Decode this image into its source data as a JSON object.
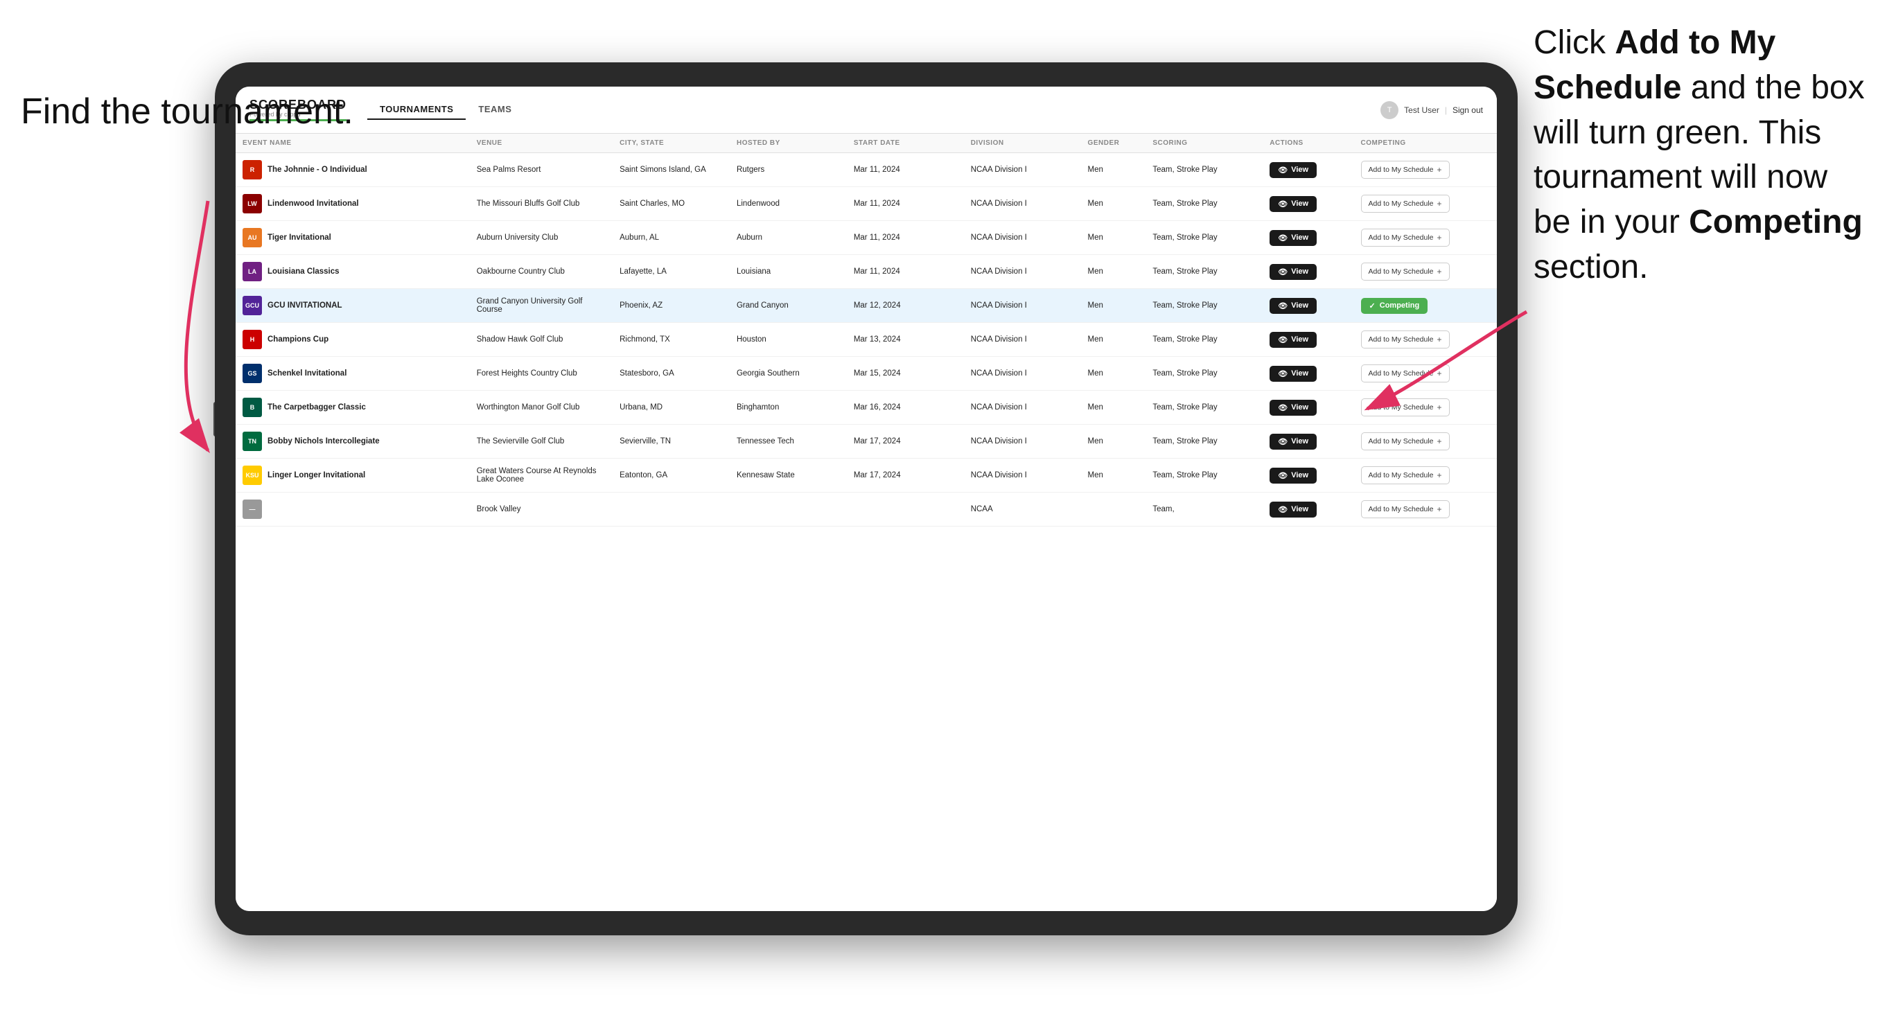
{
  "annotations": {
    "left_title": "Find the tournament.",
    "right_title_pre": "Click ",
    "right_title_bold1": "Add to My Schedule",
    "right_title_mid": " and the box will turn green. This tournament will now be in your ",
    "right_title_bold2": "Competing",
    "right_title_post": " section."
  },
  "header": {
    "logo": "SCOREBOARD",
    "logo_powered": "Powered by clippd",
    "nav": [
      "TOURNAMENTS",
      "TEAMS"
    ],
    "active_nav": "TOURNAMENTS",
    "user_label": "Test User",
    "signout_label": "Sign out"
  },
  "table": {
    "columns": [
      "EVENT NAME",
      "VENUE",
      "CITY, STATE",
      "HOSTED BY",
      "START DATE",
      "DIVISION",
      "GENDER",
      "SCORING",
      "ACTIONS",
      "COMPETING"
    ],
    "rows": [
      {
        "logo_text": "R",
        "logo_color": "#cc2200",
        "event": "The Johnnie - O Individual",
        "venue": "Sea Palms Resort",
        "city": "Saint Simons Island, GA",
        "hosted": "Rutgers",
        "date": "Mar 11, 2024",
        "division": "NCAA Division I",
        "gender": "Men",
        "scoring": "Team, Stroke Play",
        "status": "add",
        "highlighted": false
      },
      {
        "logo_text": "LW",
        "logo_color": "#8B0000",
        "event": "Lindenwood Invitational",
        "venue": "The Missouri Bluffs Golf Club",
        "city": "Saint Charles, MO",
        "hosted": "Lindenwood",
        "date": "Mar 11, 2024",
        "division": "NCAA Division I",
        "gender": "Men",
        "scoring": "Team, Stroke Play",
        "status": "add",
        "highlighted": false
      },
      {
        "logo_text": "AU",
        "logo_color": "#E87722",
        "event": "Tiger Invitational",
        "venue": "Auburn University Club",
        "city": "Auburn, AL",
        "hosted": "Auburn",
        "date": "Mar 11, 2024",
        "division": "NCAA Division I",
        "gender": "Men",
        "scoring": "Team, Stroke Play",
        "status": "add",
        "highlighted": false
      },
      {
        "logo_text": "LA",
        "logo_color": "#702082",
        "event": "Louisiana Classics",
        "venue": "Oakbourne Country Club",
        "city": "Lafayette, LA",
        "hosted": "Louisiana",
        "date": "Mar 11, 2024",
        "division": "NCAA Division I",
        "gender": "Men",
        "scoring": "Team, Stroke Play",
        "status": "add",
        "highlighted": false
      },
      {
        "logo_text": "GCU",
        "logo_color": "#522398",
        "event": "GCU INVITATIONAL",
        "venue": "Grand Canyon University Golf Course",
        "city": "Phoenix, AZ",
        "hosted": "Grand Canyon",
        "date": "Mar 12, 2024",
        "division": "NCAA Division I",
        "gender": "Men",
        "scoring": "Team, Stroke Play",
        "status": "competing",
        "highlighted": true
      },
      {
        "logo_text": "H",
        "logo_color": "#cc0000",
        "event": "Champions Cup",
        "venue": "Shadow Hawk Golf Club",
        "city": "Richmond, TX",
        "hosted": "Houston",
        "date": "Mar 13, 2024",
        "division": "NCAA Division I",
        "gender": "Men",
        "scoring": "Team, Stroke Play",
        "status": "add",
        "highlighted": false
      },
      {
        "logo_text": "GS",
        "logo_color": "#002F6C",
        "event": "Schenkel Invitational",
        "venue": "Forest Heights Country Club",
        "city": "Statesboro, GA",
        "hosted": "Georgia Southern",
        "date": "Mar 15, 2024",
        "division": "NCAA Division I",
        "gender": "Men",
        "scoring": "Team, Stroke Play",
        "status": "add",
        "highlighted": false
      },
      {
        "logo_text": "B",
        "logo_color": "#005A43",
        "event": "The Carpetbagger Classic",
        "venue": "Worthington Manor Golf Club",
        "city": "Urbana, MD",
        "hosted": "Binghamton",
        "date": "Mar 16, 2024",
        "division": "NCAA Division I",
        "gender": "Men",
        "scoring": "Team, Stroke Play",
        "status": "add",
        "highlighted": false
      },
      {
        "logo_text": "TN",
        "logo_color": "#006B3F",
        "event": "Bobby Nichols Intercollegiate",
        "venue": "The Sevierville Golf Club",
        "city": "Sevierville, TN",
        "hosted": "Tennessee Tech",
        "date": "Mar 17, 2024",
        "division": "NCAA Division I",
        "gender": "Men",
        "scoring": "Team, Stroke Play",
        "status": "add",
        "highlighted": false
      },
      {
        "logo_text": "KSU",
        "logo_color": "#FFCB00",
        "event": "Linger Longer Invitational",
        "venue": "Great Waters Course At Reynolds Lake Oconee",
        "city": "Eatonton, GA",
        "hosted": "Kennesaw State",
        "date": "Mar 17, 2024",
        "division": "NCAA Division I",
        "gender": "Men",
        "scoring": "Team, Stroke Play",
        "status": "add",
        "highlighted": false
      },
      {
        "logo_text": "—",
        "logo_color": "#999",
        "event": "",
        "venue": "Brook Valley",
        "city": "",
        "hosted": "",
        "date": "",
        "division": "NCAA",
        "gender": "",
        "scoring": "Team,",
        "status": "add",
        "highlighted": false
      }
    ],
    "view_label": "View",
    "add_label": "Add to My Schedule",
    "competing_label": "Competing"
  }
}
